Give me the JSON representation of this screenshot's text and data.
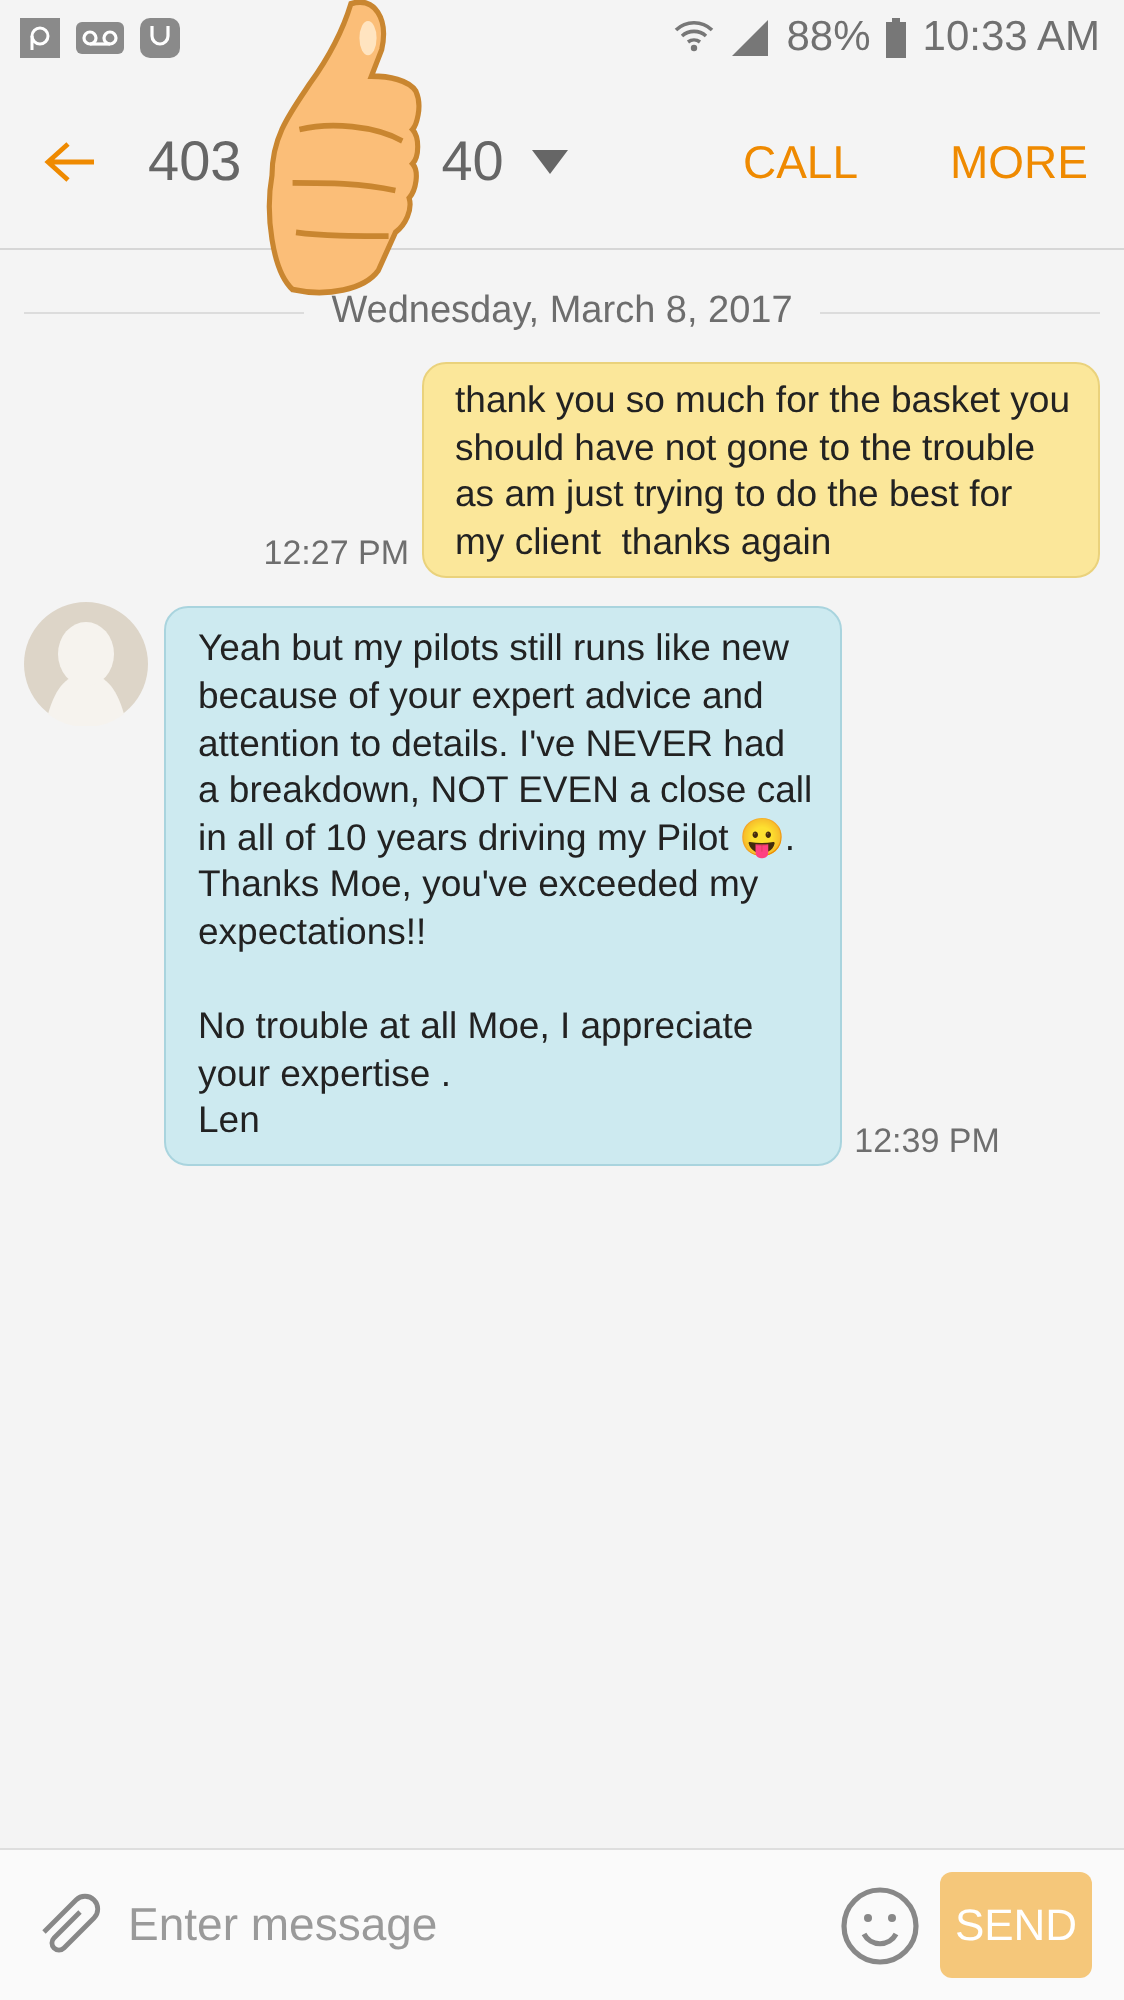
{
  "status_bar": {
    "battery": "88%",
    "time": "10:33 AM"
  },
  "header": {
    "title_parts": [
      "403",
      "40"
    ],
    "actions": [
      "CALL",
      "MORE"
    ]
  },
  "date_divider": "Wednesday, March 8, 2017",
  "messages": [
    {
      "kind": "sent",
      "text": "thank you so much for the basket you\nshould have not gone to the trouble\nas am just trying to do the best for\nmy client  thanks again",
      "time": "12:27 PM"
    },
    {
      "kind": "received",
      "text": "Yeah but my pilots still runs like new\nbecause of your expert advice and\nattention to details. I've NEVER had\na breakdown, NOT EVEN a close call\nin all of 10 years driving my Pilot 😛.\nThanks Moe, you've exceeded my\nexpectations!!\n\nNo trouble at all Moe, I appreciate\nyour expertise .\nLen",
      "time": "12:39 PM"
    }
  ],
  "composer": {
    "placeholder": "Enter message",
    "send": {
      "label": "SEND",
      "disabled": true
    }
  }
}
